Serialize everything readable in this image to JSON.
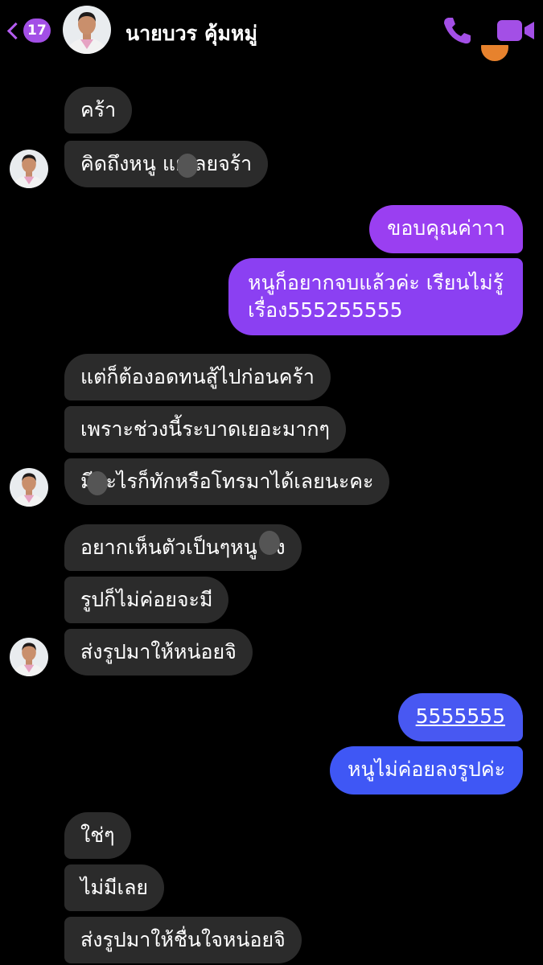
{
  "header": {
    "back_count": "17",
    "contact_name": "นายบวร คุ้มหมู่"
  },
  "colors": {
    "accent": "#a34fe6",
    "incoming_bubble": "#2b2b2b",
    "outgoing_purple": "#8b3ff0",
    "outgoing_blue": "#3f57f5",
    "background": "#000000"
  },
  "messages": [
    {
      "dir": "in",
      "text": "คร้า"
    },
    {
      "dir": "in",
      "text": "คิดถึงหนู    แย่เลยจร้า"
    },
    {
      "dir": "out",
      "text": "ขอบคุณค่าาา"
    },
    {
      "dir": "out",
      "text": "หนูก็อยากจบแล้วค่ะ เรียนไม่รู้เรื่อง555255555",
      "lines": [
        "หนูก็อยากจบแล้วค่ะ เรียนไม่รู้",
        "เรื่อง555255555"
      ]
    },
    {
      "dir": "in",
      "text": "แต่ก็ต้องอดทนสู้ไปก่อนคร้า"
    },
    {
      "dir": "in",
      "text": "เพราะช่วงนี้ระบาดเยอะมากๆ"
    },
    {
      "dir": "in",
      "text": "    มีอะไรก็ทักหรือโทรมาได้เลยนะคะ"
    },
    {
      "dir": "in",
      "text": "อยากเห็นตัวเป็นๆหนู    จัง"
    },
    {
      "dir": "in",
      "text": "รูปก็ไม่ค่อยจะมี"
    },
    {
      "dir": "in",
      "text": "ส่งรูปมาให้หน่อยจิ"
    },
    {
      "dir": "out",
      "text": "5555555"
    },
    {
      "dir": "out",
      "text": "หนูไม่ค่อยลงรูปค่ะ"
    },
    {
      "dir": "in",
      "text": "ใช่ๆ"
    },
    {
      "dir": "in",
      "text": "ไม่มีเลย"
    },
    {
      "dir": "in",
      "text": "ส่งรูปมาให้ชื่นใจหน่อยจิ"
    }
  ]
}
